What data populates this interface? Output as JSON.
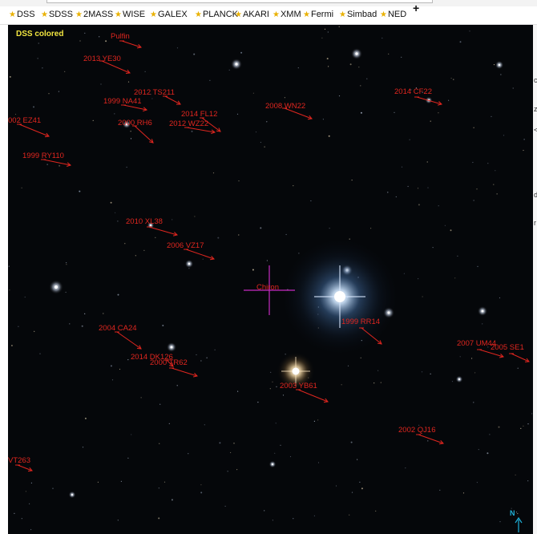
{
  "toolbar": {
    "surveys": [
      "DSS",
      "SDSS",
      "2MASS",
      "WISE",
      "GALEX",
      "PLANCK",
      "AKARI",
      "XMM",
      "Fermi",
      "Simbad",
      "NED"
    ],
    "add_label": "+"
  },
  "viewer": {
    "survey_label": "DSS colored",
    "target_label": "Chiron",
    "compass_label": "N",
    "objects": [
      "Pulfin",
      "2013 YE30",
      "2012 TS211",
      "1999 NA41",
      "2014 FL12",
      "2012 WZ22",
      "2000 RH6",
      "002 EZ41",
      "2008 WN22",
      "2014 CF22",
      "1999 RY110",
      "2010 XL38",
      "2006 VZ17",
      "1999 RR14",
      "2004 CA24",
      "2014 DK126",
      "2000 TR62",
      "2007 UM44",
      "2005 SE1",
      "2003 YB61",
      "2002 QJ16",
      "VT263"
    ]
  },
  "colors": {
    "label": "#e0261f",
    "survey_label": "#f2e640",
    "reticle": "#c62bc2",
    "compass": "#1fb0d8",
    "star_icon": "#e9b100"
  },
  "right_panel": {
    "glyphs": [
      "c",
      "z",
      "<",
      "d",
      "r"
    ]
  }
}
